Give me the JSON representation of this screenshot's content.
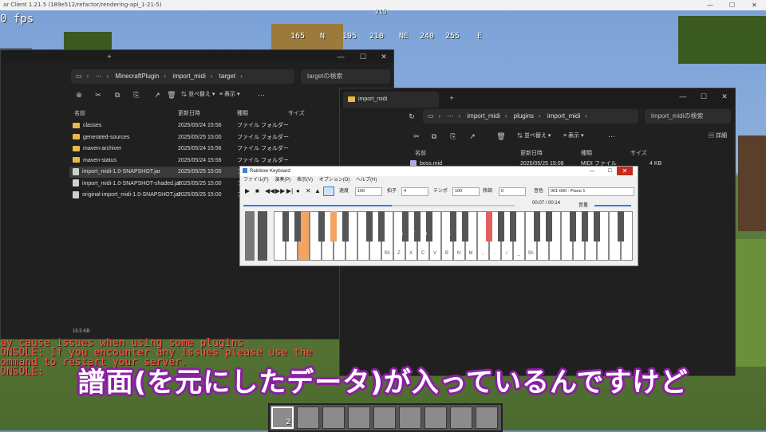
{
  "minecraft": {
    "window_title": "ar Client 1.21.5 (189e512/refactor/rendering-api_1-21-5)",
    "fps": "0 fps",
    "compass": [
      "165",
      "N",
      "195",
      "210",
      "NE",
      "240",
      "255",
      "E"
    ],
    "compass_top": "215",
    "chat_lines": [
      "ay cause issues when using some plugins",
      "ONSOLE: If you encounter any issues please use the",
      "ommand to restart your server.",
      "ONSOLE: "
    ],
    "hotbar_count": "2"
  },
  "explorer1": {
    "path": [
      "MinecraftPlugin",
      "import_midi",
      "target"
    ],
    "search_placeholder": "targetの検索",
    "toolbar": {
      "sort": "並べ替え",
      "view": "表示"
    },
    "columns": [
      "名前",
      "更新日時",
      "種類",
      "サイズ"
    ],
    "rows": [
      {
        "name": "classes",
        "date": "2025/05/24 15:56",
        "type": "ファイル フォルダー",
        "icon": "folder"
      },
      {
        "name": "generated-sources",
        "date": "2025/05/25 15:00",
        "type": "ファイル フォルダー",
        "icon": "folder"
      },
      {
        "name": "maven-archiver",
        "date": "2025/05/24 15:56",
        "type": "ファイル フォルダー",
        "icon": "folder"
      },
      {
        "name": "maven-status",
        "date": "2025/05/24 15:56",
        "type": "ファイル フォルダー",
        "icon": "folder"
      },
      {
        "name": "import_midi-1.0-SNAPSHOT.jar",
        "date": "2025/05/25 15:00",
        "type": "ファイル フォルダー",
        "icon": "jar"
      },
      {
        "name": "import_midi-1.0-SNAPSHOT-shaded.jar",
        "date": "2025/05/25 15:00",
        "type": "ファイル フォルダー",
        "icon": "jar"
      },
      {
        "name": "original-import_midi-1.0-SNAPSHOT.jar",
        "date": "2025/05/25 15:00",
        "type": "ファイル フォルダー",
        "icon": "jar"
      }
    ],
    "status": "15.5 KB"
  },
  "explorer2": {
    "tab_title": "import_midi",
    "path": [
      "import_midi",
      "plugins",
      "import_midi"
    ],
    "search_placeholder": "import_midiの検索",
    "toolbar": {
      "sort": "並べ替え",
      "view": "表示",
      "details": "詳細"
    },
    "columns": [
      "名前",
      "更新日時",
      "種類",
      "サイズ"
    ],
    "rows": [
      {
        "name": "boss.mid",
        "date": "2025/05/25 15:08",
        "type": "MIDI ファイル",
        "size": "4 KB"
      }
    ]
  },
  "rainbow": {
    "title": "Rainbow Keyboard",
    "menu": [
      "ファイル(F)",
      "演奏(P)",
      "表示(V)",
      "オプション(O)",
      "ヘルプ(H)"
    ],
    "controls": {
      "speed_label": "速度",
      "speed": "100",
      "beat_label": "拍子",
      "beat": "4",
      "tempo_label": "テンポ",
      "tempo": "100",
      "transpose_label": "移調",
      "transpose": "0",
      "tone_label": "音色",
      "tone": "001-000 : Piano 1"
    },
    "time": "00:07 / 00:14",
    "volume_label": "音量",
    "key_labels_top": [
      "A",
      "S",
      "F",
      "G",
      "J",
      "K",
      "L",
      ";",
      "]"
    ],
    "key_labels_bottom": [
      "Sh",
      "Z",
      "X",
      "C",
      "V",
      "B",
      "N",
      "M",
      ",",
      ".",
      "/",
      "_",
      "Sh"
    ],
    "highlight_color": "#f4a460",
    "highlight_red": "#e06060"
  },
  "subtitle": "譜面(を元にしたデータ)が入っているんですけど"
}
